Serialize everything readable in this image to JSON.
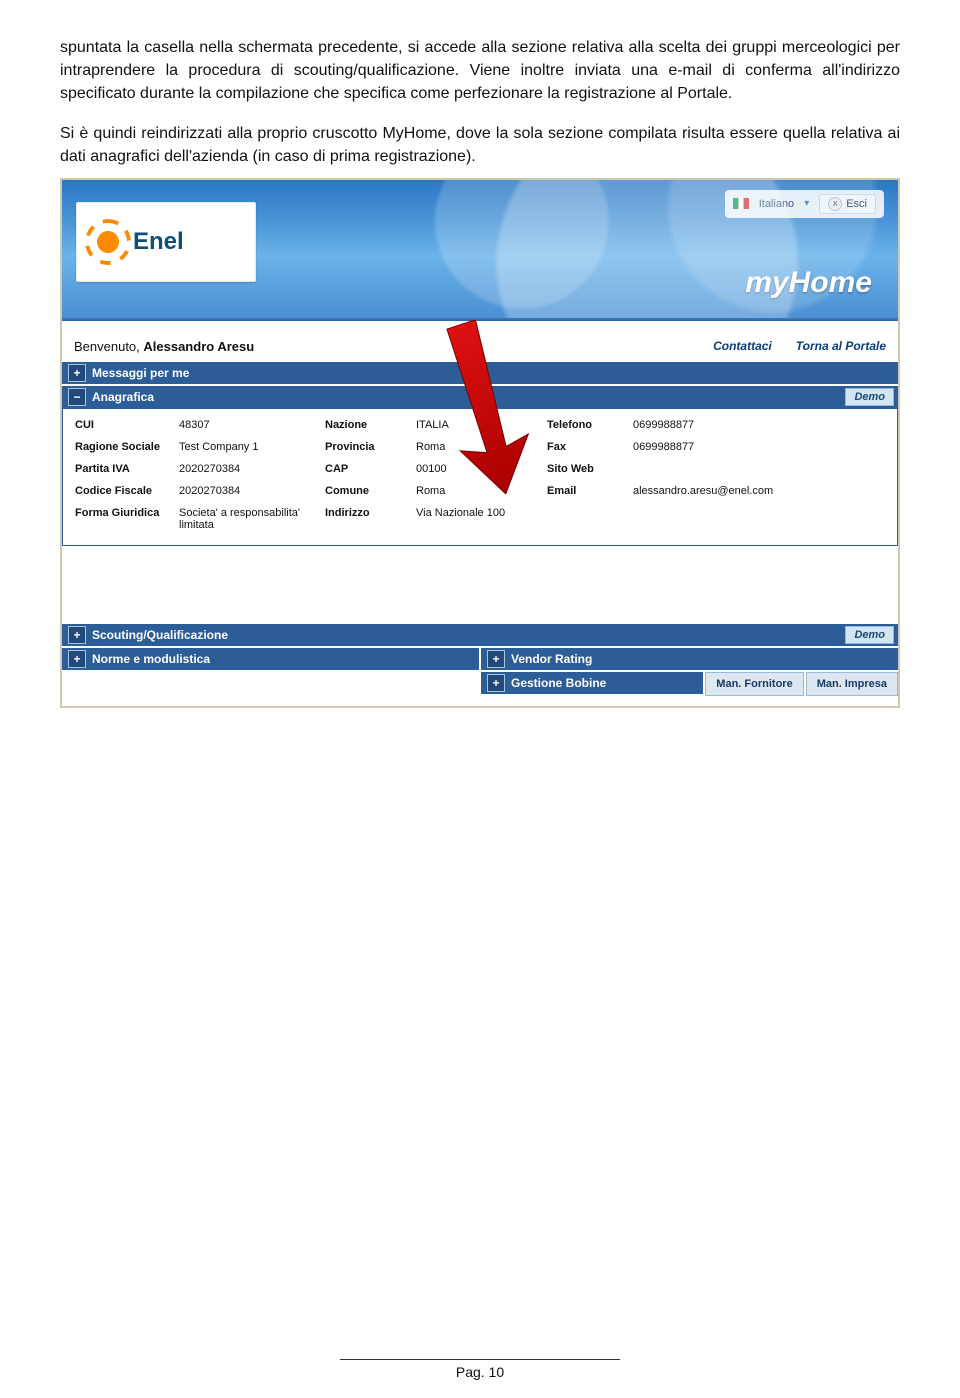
{
  "paragraphs": {
    "p1": "spuntata la casella nella schermata precedente, si accede alla sezione relativa alla scelta dei gruppi merceologici per intraprendere la procedura di scouting/qualificazione. Viene inoltre inviata una e-mail di conferma all'indirizzo specificato durante la compilazione che specifica come perfezionare la registrazione al Portale.",
    "p2": "Si è quindi reindirizzati alla proprio cruscotto MyHome, dove la sola sezione compilata risulta essere quella relativa ai dati anagrafici dell'azienda (in caso di prima registrazione)."
  },
  "screenshot": {
    "language": "Italiano",
    "logout": "Esci",
    "brand": "Enel",
    "title": "myHome",
    "welcome_prefix": "Benvenuto, ",
    "welcome_name": "Alessandro Aresu",
    "links": {
      "contact": "Contattaci",
      "back": "Torna al Portale"
    },
    "bars": {
      "messages": "Messaggi per me",
      "anagrafica": "Anagrafica",
      "scouting": "Scouting/Qualificazione",
      "norme": "Norme e modulistica",
      "vendor": "Vendor Rating",
      "bobine": "Gestione Bobine",
      "demo": "Demo",
      "man_fornitore": "Man. Fornitore",
      "man_impresa": "Man. Impresa"
    },
    "anagrafica": {
      "rows": [
        {
          "l1": "CUI",
          "v1": "48307",
          "l2": "Nazione",
          "v2": "ITALIA",
          "l3": "Telefono",
          "v3": "0699988877"
        },
        {
          "l1": "Ragione Sociale",
          "v1": "Test Company 1",
          "l2": "Provincia",
          "v2": "Roma",
          "l3": "Fax",
          "v3": "0699988877"
        },
        {
          "l1": "Partita IVA",
          "v1": "2020270384",
          "l2": "CAP",
          "v2": "00100",
          "l3": "Sito Web",
          "v3": ""
        },
        {
          "l1": "Codice Fiscale",
          "v1": "2020270384",
          "l2": "Comune",
          "v2": "Roma",
          "l3": "Email",
          "v3": "alessandro.aresu@enel.com"
        },
        {
          "l1": "Forma Giuridica",
          "v1": "Societa' a responsabilita' limitata",
          "l2": "Indirizzo",
          "v2": "Via Nazionale 100",
          "l3": "",
          "v3": ""
        }
      ]
    }
  },
  "footer": "Pag. 10"
}
